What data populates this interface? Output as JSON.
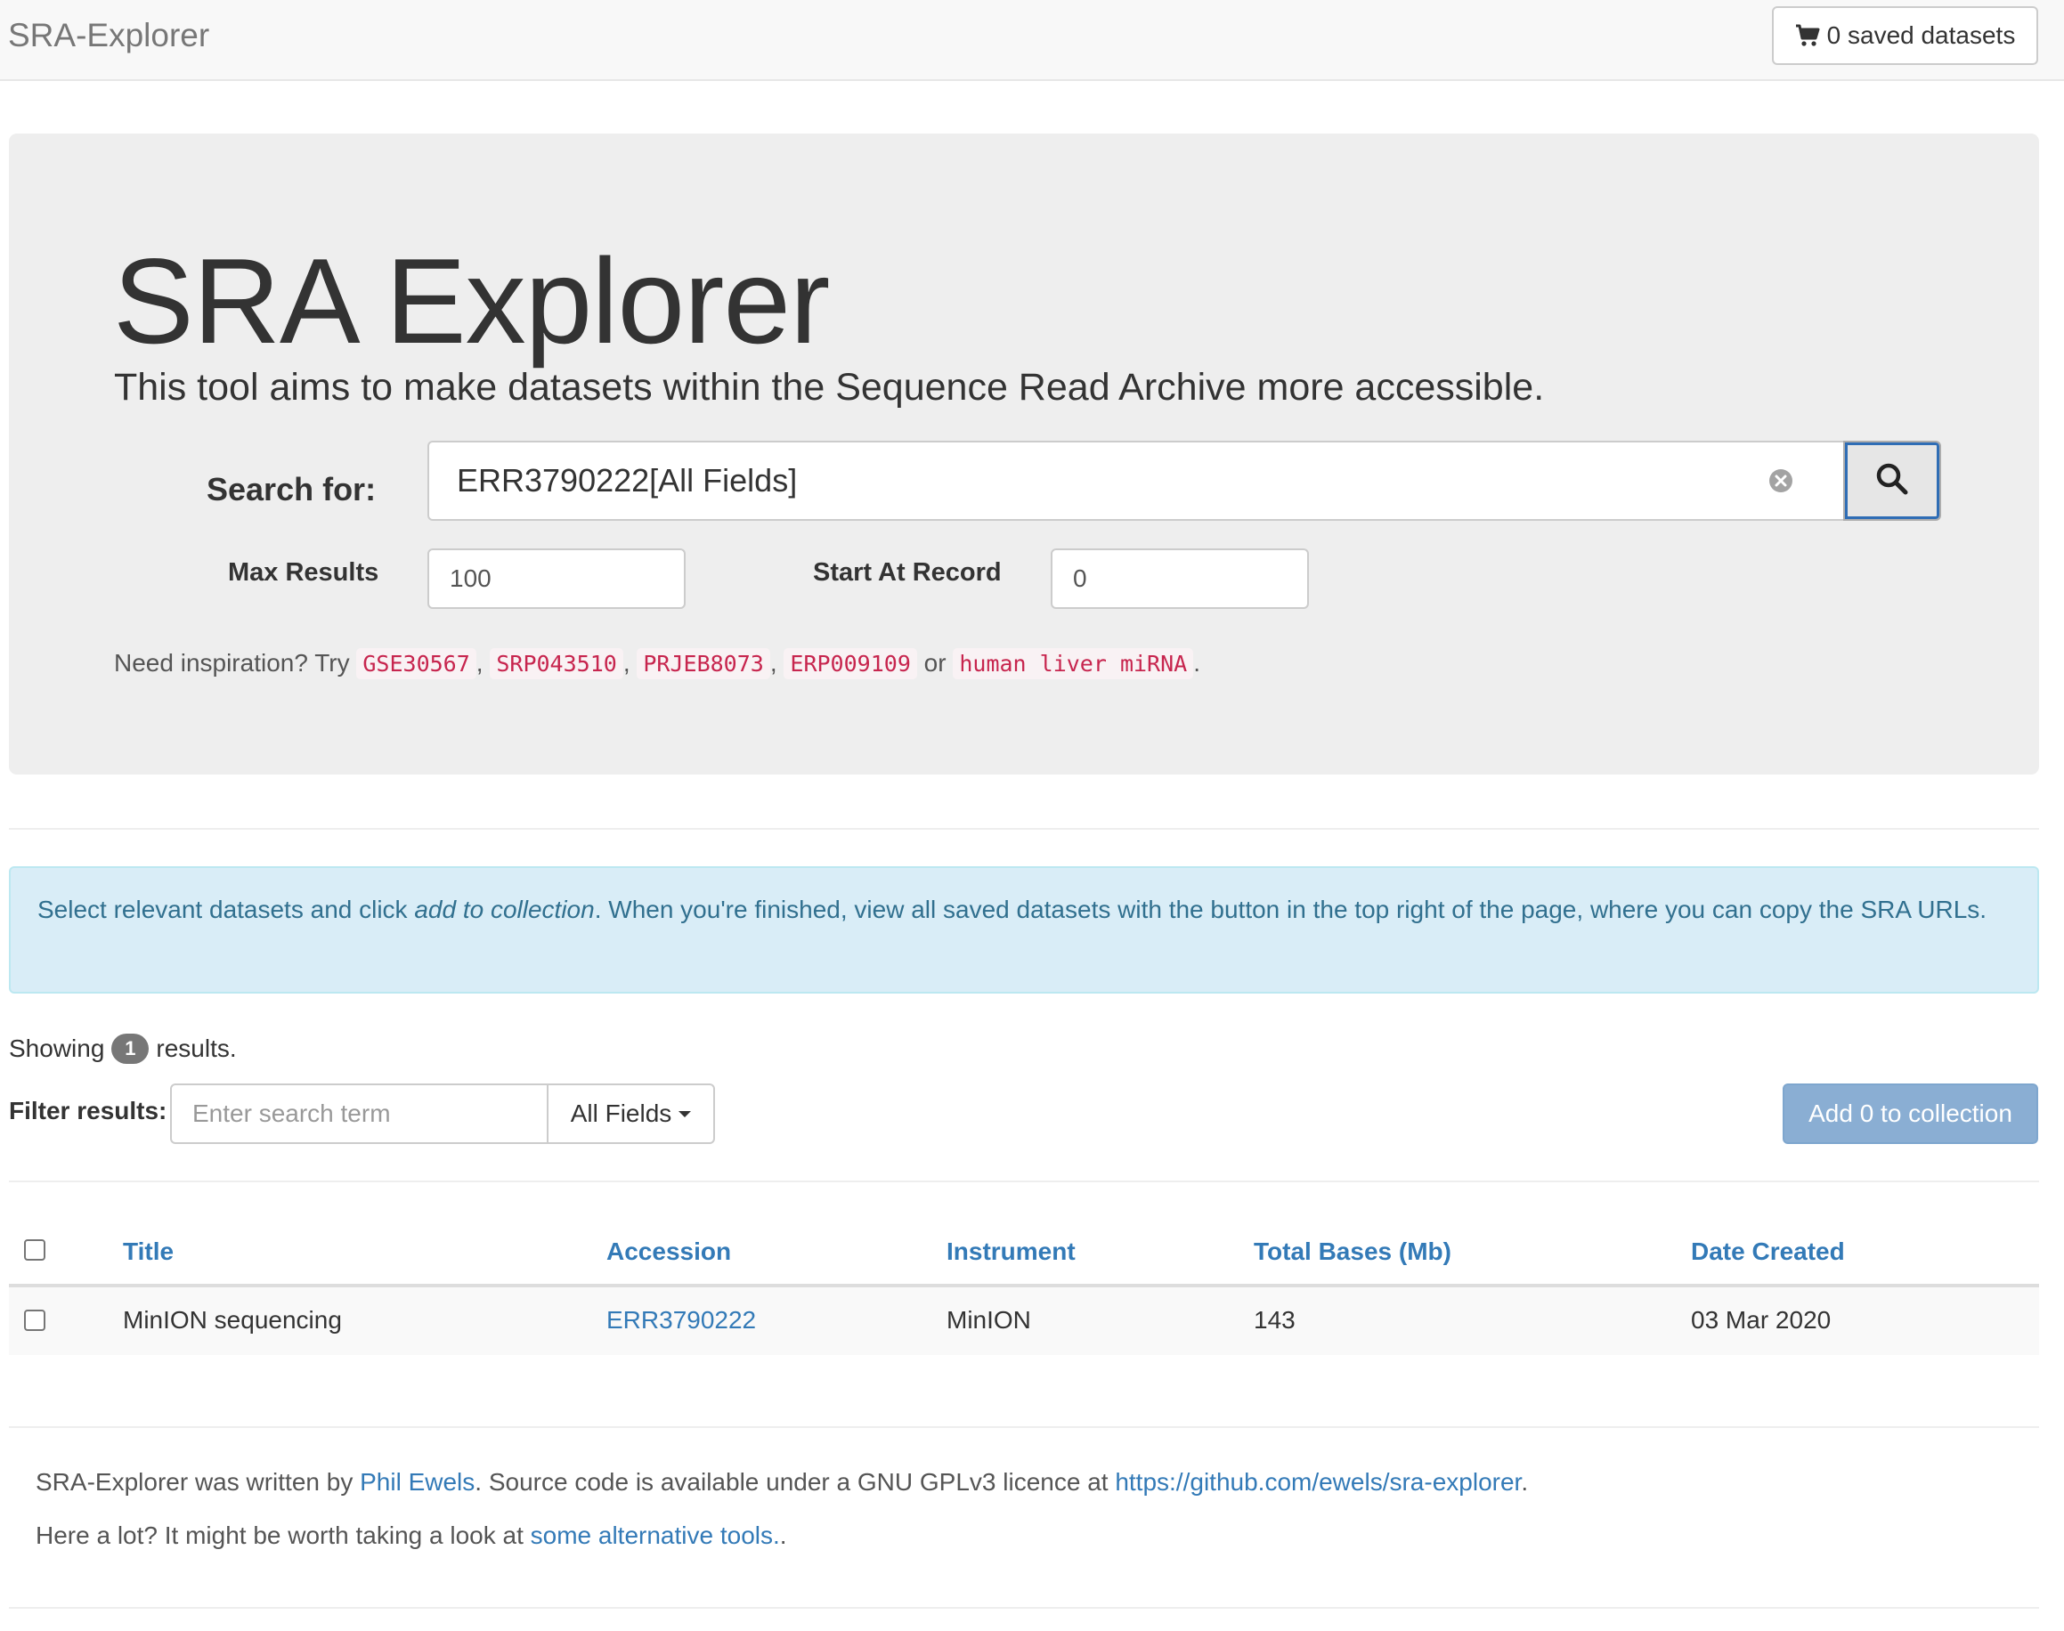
{
  "navbar": {
    "brand": "SRA-Explorer",
    "saved_button": "0 saved datasets",
    "saved_icon": "shopping-cart-icon"
  },
  "jumbotron": {
    "title": "SRA Explorer",
    "lead": "This tool aims to make datasets within the Sequence Read Archive more accessible.",
    "search_label": "Search for:",
    "search_value": "ERR3790222[All Fields]",
    "clear_icon": "clear-icon",
    "search_icon": "search-icon",
    "max_results_label": "Max Results",
    "max_results_value": "100",
    "start_record_label": "Start At Record",
    "start_record_value": "0",
    "inspiration": {
      "prefix": "Need inspiration? Try",
      "examples": [
        "GSE30567",
        "SRP043510",
        "PRJEB8073",
        "ERP009109",
        "human liver miRNA"
      ],
      "sep": ",",
      "or": "or",
      "end": "."
    }
  },
  "alert": {
    "part1": "Select relevant datasets and click ",
    "emphasis": "add to collection",
    "part2": ". When you're finished, view all saved datasets with the button in the top right of the page, where you can copy the SRA URLs."
  },
  "results": {
    "showing_prefix": "Showing",
    "count": "1",
    "showing_suffix": "results.",
    "filter_label": "Filter results:",
    "filter_placeholder": "Enter search term",
    "filter_field": "All Fields",
    "add_button": "Add 0 to collection"
  },
  "table": {
    "columns": [
      "Title",
      "Accession",
      "Instrument",
      "Total Bases (Mb)",
      "Date Created"
    ],
    "rows": [
      {
        "title": "MinION sequencing",
        "accession": "ERR3790222",
        "instrument": "MinION",
        "total_bases": "143",
        "date_created": "03 Mar 2020"
      }
    ]
  },
  "footer": {
    "line1_a": "SRA-Explorer was written by ",
    "author": "Phil Ewels",
    "line1_b": ". Source code is available under a GNU GPLv3 licence at ",
    "repo": "https://github.com/ewels/sra-explorer",
    "line1_c": ".",
    "line2_a": "Here a lot? It might be worth taking a look at ",
    "alt_link": "some alternative tools.",
    "line2_b": "."
  },
  "colors": {
    "link": "#337ab7",
    "code": "#c7254e",
    "alert_bg": "#d9edf7",
    "alert_text": "#31708f",
    "primary_disabled": "#8aaed3"
  }
}
